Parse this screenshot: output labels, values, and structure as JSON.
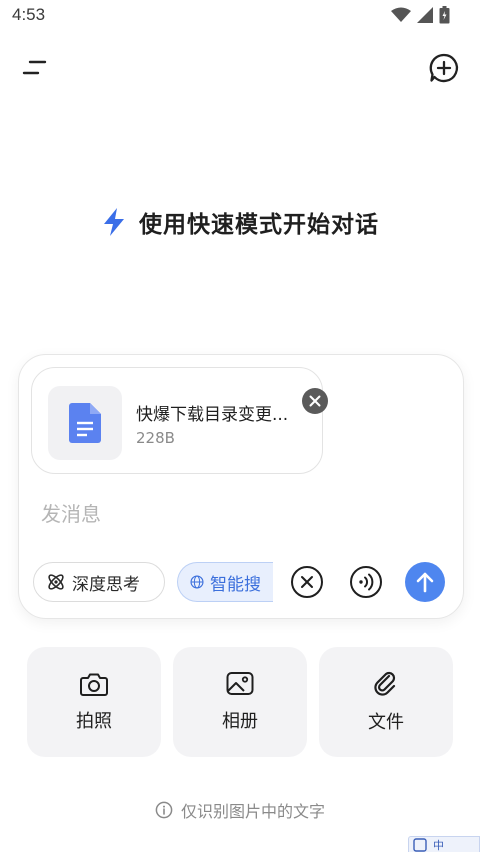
{
  "status_bar": {
    "time": "4:53",
    "icons": [
      "wifi-icon",
      "signal-icon",
      "battery-icon"
    ]
  },
  "header": {
    "menu_icon": "menu-icon",
    "new_chat_icon": "new-chat-icon"
  },
  "hero": {
    "icon": "lightning-icon",
    "title": "使用快速模式开始对话"
  },
  "composer": {
    "attachment": {
      "file_name": "快爆下载目录变更...",
      "file_size": "228B",
      "icon": "document-icon"
    },
    "message_placeholder": "发消息",
    "chips": {
      "deep_think": "深度思考",
      "smart_search": "智能搜"
    },
    "buttons": [
      "clear-icon",
      "voice-icon",
      "send-icon"
    ]
  },
  "tools": [
    {
      "label": "拍照",
      "icon": "camera-icon"
    },
    {
      "label": "相册",
      "icon": "image-icon"
    },
    {
      "label": "文件",
      "icon": "paperclip-icon"
    }
  ],
  "footnote": "仅识别图片中的文字",
  "ime": {
    "label": "中"
  },
  "colors": {
    "accent": "#4e86ef",
    "hero_icon": "#3a6ee8",
    "file_icon": "#5b82f0",
    "chip_active_bg": "#e8effd"
  }
}
